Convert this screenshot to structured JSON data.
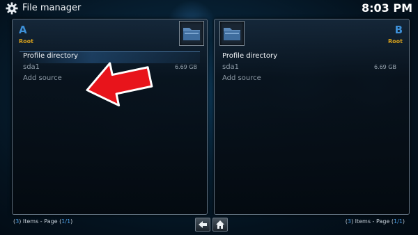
{
  "header": {
    "title": "File manager",
    "clock": "8:03 PM"
  },
  "panel_a": {
    "letter": "A",
    "sub": "Root",
    "items": [
      {
        "label": "Profile directory",
        "size": ""
      },
      {
        "label": "sda1",
        "size": "6.69 GB"
      },
      {
        "label": "Add source",
        "size": ""
      }
    ],
    "footer": {
      "count": "3",
      "items_text": " Items - Page ",
      "page": "1/1"
    }
  },
  "panel_b": {
    "letter": "B",
    "sub": "Root",
    "items": [
      {
        "label": "Profile directory",
        "size": ""
      },
      {
        "label": "sda1",
        "size": "6.69 GB"
      },
      {
        "label": "Add source",
        "size": ""
      }
    ],
    "footer": {
      "count": "3",
      "items_text": " Items - Page ",
      "page": "1/1"
    }
  },
  "colors": {
    "accent_blue": "#3d90d8",
    "sub_orange": "#d6a01c",
    "arrow_red": "#e8141b"
  },
  "icons": [
    "gear-icon",
    "folder-icon",
    "back-arrow-icon",
    "home-icon",
    "red-pointer-arrow"
  ]
}
